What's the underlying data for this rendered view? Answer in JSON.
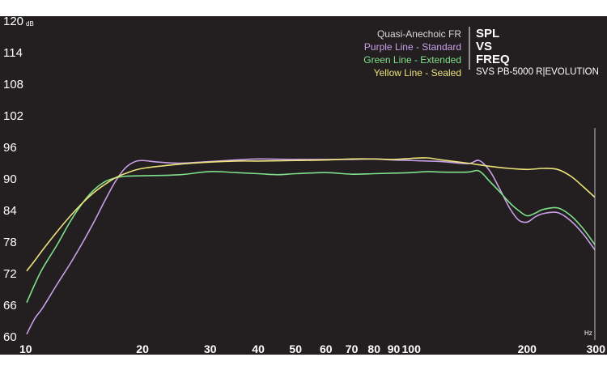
{
  "chart_data": {
    "type": "line",
    "title": "SPL VS FREQ",
    "title_lines": [
      "SPL",
      "VS",
      "FREQ"
    ],
    "subtitle": "SVS PB-5000 R|EVOLUTION",
    "legend_title": "Quasi-Anechoic FR",
    "legend_placement": "top-right",
    "ylabel": "dB",
    "xlabel": "Hz",
    "xscale": "log",
    "xlim": [
      10,
      300
    ],
    "ylim": [
      60,
      120
    ],
    "yticks": [
      60,
      66,
      72,
      78,
      84,
      90,
      96,
      102,
      108,
      114,
      120
    ],
    "xticks": [
      10,
      20,
      30,
      40,
      50,
      60,
      70,
      80,
      90,
      100,
      200,
      300
    ],
    "xtick_labels": [
      "10",
      "20",
      "30",
      "40",
      "50",
      "60",
      "70",
      "80",
      "90",
      "100",
      "200",
      "300"
    ],
    "grid": false,
    "background": "#231f20",
    "series": [
      {
        "name": "Purple Line - Standard",
        "color": "#c9a0e8",
        "points": [
          [
            10,
            60.5
          ],
          [
            10.5,
            63.5
          ],
          [
            11,
            65.5
          ],
          [
            12,
            70
          ],
          [
            13,
            74
          ],
          [
            14,
            78
          ],
          [
            15,
            82
          ],
          [
            16,
            86
          ],
          [
            17,
            89.5
          ],
          [
            18,
            92
          ],
          [
            19,
            93.2
          ],
          [
            20,
            93.5
          ],
          [
            22,
            93.2
          ],
          [
            25,
            93
          ],
          [
            30,
            93.3
          ],
          [
            35,
            93.6
          ],
          [
            40,
            93.8
          ],
          [
            50,
            93.7
          ],
          [
            60,
            93.7
          ],
          [
            70,
            93.7
          ],
          [
            80,
            93.8
          ],
          [
            90,
            93.6
          ],
          [
            100,
            93.5
          ],
          [
            120,
            93.3
          ],
          [
            140,
            92.9
          ],
          [
            150,
            93.5
          ],
          [
            160,
            91.5
          ],
          [
            170,
            88
          ],
          [
            180,
            84.5
          ],
          [
            190,
            82.2
          ],
          [
            200,
            81.8
          ],
          [
            210,
            82.8
          ],
          [
            220,
            83.4
          ],
          [
            240,
            83.6
          ],
          [
            260,
            82
          ],
          [
            280,
            79.5
          ],
          [
            300,
            76.5
          ]
        ]
      },
      {
        "name": "Green Line - Extended",
        "color": "#7ee08a",
        "points": [
          [
            10,
            66.5
          ],
          [
            10.5,
            70
          ],
          [
            11,
            73
          ],
          [
            12,
            77.5
          ],
          [
            13,
            82
          ],
          [
            14,
            85.5
          ],
          [
            15,
            88
          ],
          [
            16,
            89.5
          ],
          [
            17,
            90.2
          ],
          [
            18,
            90.5
          ],
          [
            20,
            90.6
          ],
          [
            25,
            90.8
          ],
          [
            30,
            91.4
          ],
          [
            35,
            91.2
          ],
          [
            40,
            91
          ],
          [
            45,
            90.8
          ],
          [
            50,
            91
          ],
          [
            60,
            91.2
          ],
          [
            70,
            90.9
          ],
          [
            80,
            91
          ],
          [
            90,
            91.1
          ],
          [
            100,
            91.2
          ],
          [
            110,
            91.4
          ],
          [
            120,
            91.3
          ],
          [
            140,
            91.3
          ],
          [
            150,
            91.5
          ],
          [
            160,
            89.5
          ],
          [
            170,
            87.5
          ],
          [
            180,
            85.5
          ],
          [
            190,
            84
          ],
          [
            200,
            83
          ],
          [
            210,
            83.5
          ],
          [
            220,
            84.2
          ],
          [
            240,
            84.5
          ],
          [
            260,
            83
          ],
          [
            280,
            80.5
          ],
          [
            300,
            77.5
          ]
        ]
      },
      {
        "name": "Yellow Line - Sealed",
        "color": "#ece27a",
        "points": [
          [
            10,
            72.5
          ],
          [
            10.5,
            74.5
          ],
          [
            11,
            76.5
          ],
          [
            12,
            80
          ],
          [
            13,
            83
          ],
          [
            14,
            85.5
          ],
          [
            15,
            87.5
          ],
          [
            16,
            89
          ],
          [
            17,
            90.2
          ],
          [
            18,
            91
          ],
          [
            20,
            92
          ],
          [
            25,
            92.8
          ],
          [
            30,
            93.2
          ],
          [
            35,
            93.4
          ],
          [
            40,
            93.4
          ],
          [
            50,
            93.5
          ],
          [
            60,
            93.6
          ],
          [
            70,
            93.8
          ],
          [
            80,
            93.8
          ],
          [
            90,
            93.7
          ],
          [
            100,
            93.9
          ],
          [
            110,
            94
          ],
          [
            120,
            93.6
          ],
          [
            140,
            93
          ],
          [
            160,
            92.4
          ],
          [
            180,
            92
          ],
          [
            200,
            91.8
          ],
          [
            220,
            92
          ],
          [
            240,
            91.8
          ],
          [
            260,
            90.5
          ],
          [
            280,
            88.5
          ],
          [
            300,
            86.5
          ]
        ]
      }
    ]
  }
}
